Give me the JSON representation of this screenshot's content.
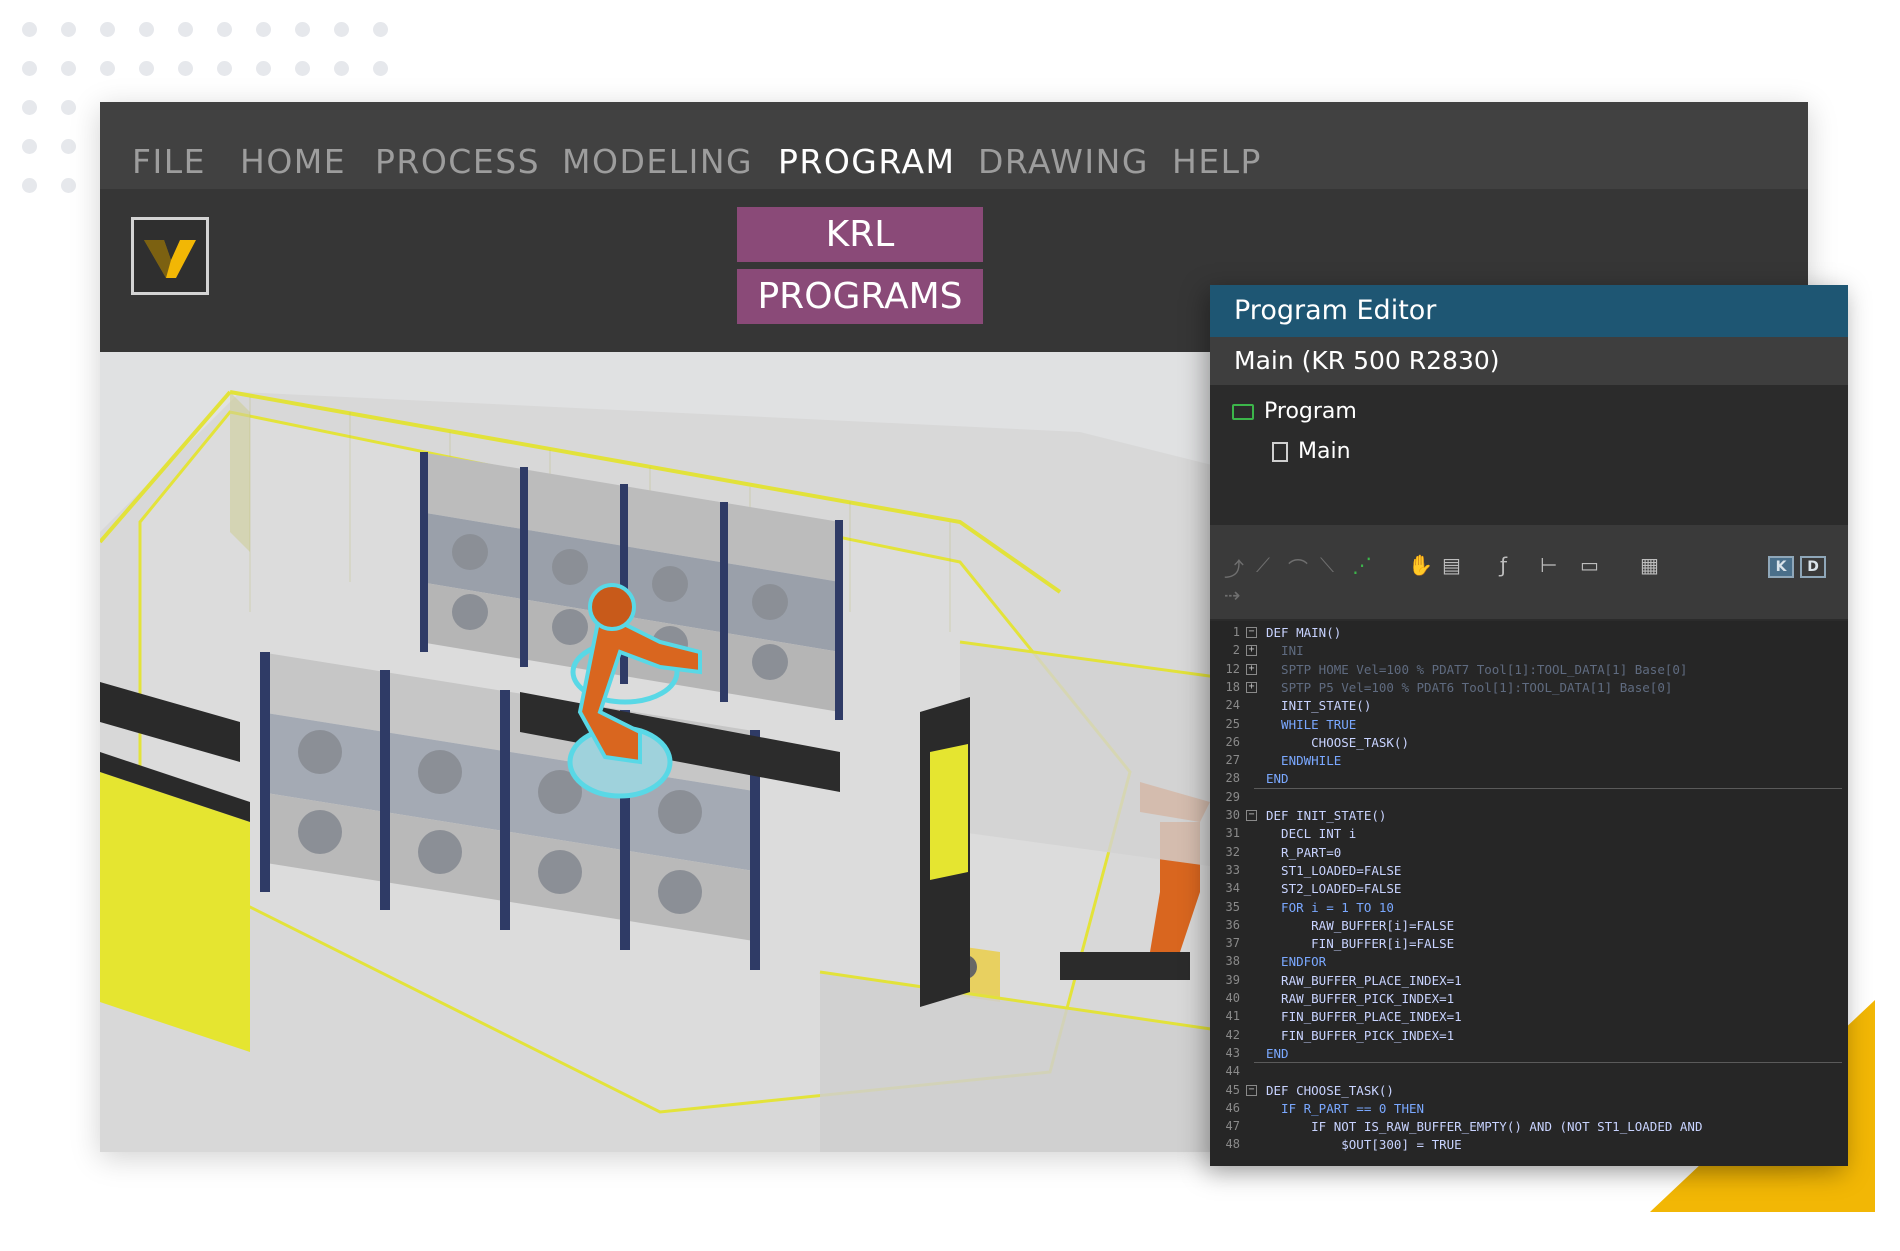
{
  "menu": {
    "items": [
      "FILE",
      "HOME",
      "PROCESS",
      "MODELING",
      "PROGRAM",
      "DRAWING",
      "HELP"
    ],
    "active": "PROGRAM"
  },
  "ribbon": {
    "krl_line1": "KRL",
    "krl_line2": "PROGRAMS"
  },
  "editor": {
    "title": "Program Editor",
    "subtitle": "Main (KR 500 R2830)",
    "tree": {
      "root": "Program",
      "child": "Main"
    },
    "mode_k": "K",
    "mode_d": "D",
    "code": [
      {
        "n": "1",
        "t": "DEF MAIN()",
        "fold": "-"
      },
      {
        "n": "2",
        "t": "  INI",
        "fold": "+",
        "dim": true
      },
      {
        "n": "12",
        "t": "  SPTP HOME Vel=100 % PDAT7 Tool[1]:TOOL_DATA[1] Base[0]",
        "fold": "+",
        "dim": true
      },
      {
        "n": "18",
        "t": "  SPTP P5 Vel=100 % PDAT6 Tool[1]:TOOL_DATA[1] Base[0]",
        "fold": "+",
        "dim": true
      },
      {
        "n": "24",
        "t": "  INIT_STATE()"
      },
      {
        "n": "25",
        "t": "  WHILE TRUE",
        "kw": true
      },
      {
        "n": "26",
        "t": "      CHOOSE_TASK()"
      },
      {
        "n": "27",
        "t": "  ENDWHILE",
        "kw": true
      },
      {
        "n": "28",
        "t": "END",
        "kw": true
      },
      {
        "n": "29",
        "t": ""
      },
      {
        "n": "30",
        "t": "DEF INIT_STATE()",
        "fold": "-"
      },
      {
        "n": "31",
        "t": "  DECL INT i"
      },
      {
        "n": "32",
        "t": "  R_PART=0"
      },
      {
        "n": "33",
        "t": "  ST1_LOADED=FALSE"
      },
      {
        "n": "34",
        "t": "  ST2_LOADED=FALSE"
      },
      {
        "n": "35",
        "t": "  FOR i = 1 TO 10",
        "kw": true
      },
      {
        "n": "36",
        "t": "      RAW_BUFFER[i]=FALSE"
      },
      {
        "n": "37",
        "t": "      FIN_BUFFER[i]=FALSE"
      },
      {
        "n": "38",
        "t": "  ENDFOR",
        "kw": true
      },
      {
        "n": "39",
        "t": "  RAW_BUFFER_PLACE_INDEX=1"
      },
      {
        "n": "40",
        "t": "  RAW_BUFFER_PICK_INDEX=1"
      },
      {
        "n": "41",
        "t": "  FIN_BUFFER_PLACE_INDEX=1"
      },
      {
        "n": "42",
        "t": "  FIN_BUFFER_PICK_INDEX=1"
      },
      {
        "n": "43",
        "t": "END",
        "kw": true
      },
      {
        "n": "44",
        "t": ""
      },
      {
        "n": "45",
        "t": "DEF CHOOSE_TASK()",
        "fold": "-"
      },
      {
        "n": "46",
        "t": "  IF R_PART == 0 THEN",
        "kw": true
      },
      {
        "n": "47",
        "t": "      IF NOT IS_RAW_BUFFER_EMPTY() AND (NOT ST1_LOADED AND"
      },
      {
        "n": "48",
        "t": "          $OUT[300] = TRUE"
      }
    ]
  },
  "icons": [
    "logo-icon",
    "folder-icon",
    "document-icon",
    "keyword-k-icon",
    "data-d-icon"
  ],
  "colors": {
    "menubar": "#414141",
    "ribbon": "#363636",
    "krl_button": "#8a4a78",
    "editor_title": "#1e5673",
    "accent_yellow": "#f2b705",
    "robot_orange": "#d9661f",
    "fence_yellow": "#e2e23a"
  }
}
